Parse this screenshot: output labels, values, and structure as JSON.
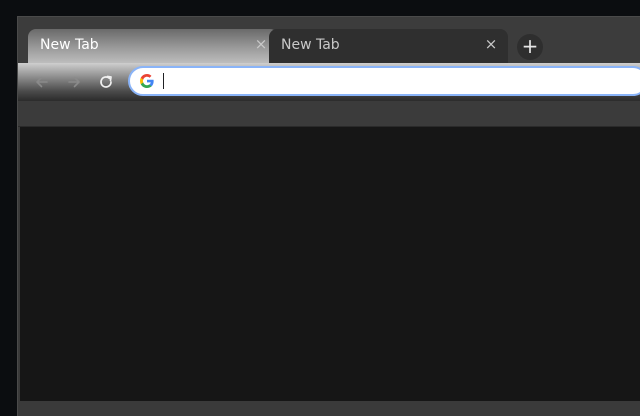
{
  "tabs": [
    {
      "title": "New Tab",
      "close_label": "×",
      "active": true
    },
    {
      "title": "New Tab",
      "close_label": "×",
      "active": false
    }
  ],
  "new_tab_label": "+",
  "omnibox": {
    "value": "",
    "placeholder": ""
  },
  "icons": {
    "back": "arrow-left-icon",
    "forward": "arrow-right-icon",
    "reload": "reload-icon",
    "search_engine": "google-icon"
  },
  "colors": {
    "page_background": "#161616",
    "focus_ring": "#8ab4f8"
  }
}
